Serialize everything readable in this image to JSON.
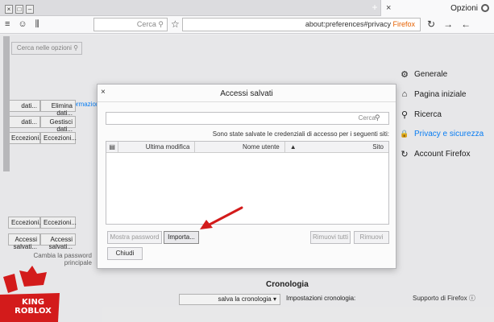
{
  "window": {
    "tab_title": "Opzioni",
    "new_tab": "+",
    "tab_close": "×",
    "win_buttons": [
      "×",
      "□",
      "–"
    ]
  },
  "toolbar": {
    "search_placeholder": "Cerca",
    "url_brand": "Firefox",
    "url_text": "about:preferences#privacy",
    "left_icons": [
      "≡",
      "☺",
      "⫼"
    ],
    "right_icons": [
      "↻",
      "→",
      "←"
    ]
  },
  "preferences": {
    "search_placeholder": "Cerca nelle opzioni",
    "sidebar": [
      {
        "label": "Generale",
        "icon": "⚙"
      },
      {
        "label": "Pagina iniziale",
        "icon": "⌂"
      },
      {
        "label": "Ricerca",
        "icon": "⚲"
      },
      {
        "label": "Privacy e sicurezza",
        "icon": "🔒"
      },
      {
        "label": "Account Firefox",
        "icon": "↻"
      }
    ],
    "left_buttons": [
      {
        "label": "Elimina dati...",
        "top": 0
      },
      {
        "label": "Gestisci dati...",
        "top": 0
      },
      {
        "label": "Eccezioni...",
        "top": 0
      }
    ],
    "left_buttons_lower": [
      "Eccezioni...",
      "Accessi salvati..."
    ],
    "left_labels": [
      "Eccezioni...",
      "Accessi salvati..."
    ],
    "link_informazioni": "informazioni",
    "change_master": "Cambia la password principale",
    "cronologia_title": "Cronologia",
    "cronologia_label": "Impostazioni cronologia:",
    "cronologia_value": "salva la cronologia",
    "support": "Supporto di Firefox"
  },
  "dialog": {
    "title": "Accessi salvati",
    "close": "×",
    "search_placeholder": "Cerca",
    "description": "Sono state salvate le credenziali di accesso per i seguenti siti:",
    "columns": [
      "Sito",
      "Nome utente",
      "Ultima modifica"
    ],
    "buttons": {
      "remove": "Rimuovi",
      "remove_all": "Rimuovi tutti",
      "import": "Importa...",
      "show_passwords": "Mostra password",
      "close": "Chiudi"
    }
  },
  "watermark": {
    "line1": "KING",
    "line2": "ROBLOX"
  },
  "colors": {
    "accent": "#0a84ff",
    "arrow": "#d31b1b",
    "logo": "#d31b1b"
  }
}
